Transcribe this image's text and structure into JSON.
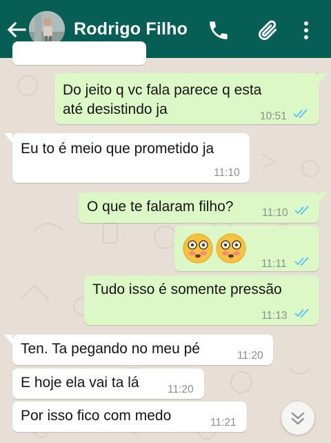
{
  "header": {
    "contact_name": "Rodrigo Filho",
    "bg_color": "#075e54",
    "icons": [
      "back-arrow-icon",
      "phone-icon",
      "paperclip-icon",
      "more-vertical-icon"
    ]
  },
  "messages": [
    {
      "direction": "out",
      "lines": [
        "Do jeito q vc fala parece q esta",
        "até desistindo ja"
      ],
      "time": "10:51",
      "status": "read"
    },
    {
      "direction": "in",
      "lines": [
        "Eu to é meio que prometido ja"
      ],
      "time": "11:10"
    },
    {
      "direction": "out",
      "lines": [
        "O que te falaram filho?"
      ],
      "time": "11:10",
      "status": "read"
    },
    {
      "direction": "out",
      "emoji": [
        "flushed-face",
        "flushed-face"
      ],
      "time": "11:11",
      "status": "read"
    },
    {
      "direction": "out",
      "lines": [
        "Tudo isso é somente pressão"
      ],
      "time": "11:13",
      "status": "read"
    },
    {
      "direction": "in",
      "lines": [
        "Ten. Ta pegando no meu pé"
      ],
      "time": "11:20"
    },
    {
      "direction": "in",
      "lines": [
        "E hoje ela vai ta lá"
      ],
      "time": "11:20"
    },
    {
      "direction": "in",
      "lines": [
        "Por isso fico com medo"
      ],
      "time": "11:21"
    }
  ],
  "colors": {
    "incoming_bubble": "#ffffff",
    "outgoing_bubble": "#dcf8c6",
    "read_ticks": "#4fc3f7",
    "chat_background": "#e7dfd6"
  }
}
